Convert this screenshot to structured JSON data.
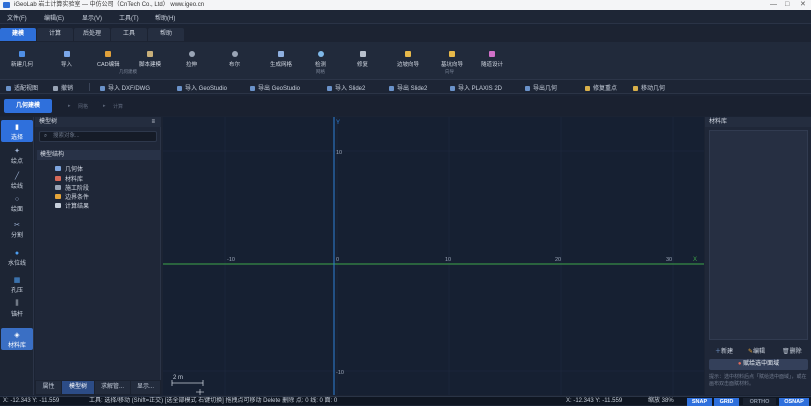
{
  "window": {
    "title": "iGeoLab 岩土计算实验室 — 中仿公司（CnTech Co., Ltd）  www.igeo.cn",
    "minimize": "—",
    "maximize": "□",
    "close": "✕"
  },
  "menu": [
    "文件(F)",
    "编辑(E)",
    "显示(V)",
    "工具(T)",
    "帮助(H)"
  ],
  "tabs": [
    "建模",
    "计算",
    "后处理",
    "工具",
    "帮助"
  ],
  "ribbon": {
    "buttons": [
      "新建几何",
      "导入",
      "CAD编辑",
      "脚本建模",
      "拉伸",
      "布尔",
      "生成网格",
      "检测",
      "修复",
      "边坡向导",
      "基坑向导",
      "隧道设计"
    ],
    "groups": [
      "几何建模",
      "网格",
      "向导"
    ]
  },
  "toolbar2": [
    "适配视图",
    "撤销",
    "导入 DXF/DWG",
    "导入 GeoStudio",
    "导出 GeoStudio",
    "导入 Slide2",
    "导出 Slide2",
    "导入 PLAXIS 2D",
    "导出几何",
    "修复重点",
    "移动几何"
  ],
  "mode": {
    "active": "几何建模",
    "crumbs": [
      "▸",
      "网格",
      "▸",
      "计算"
    ]
  },
  "left_tools": [
    "选择",
    "绘点",
    "绘线",
    "绘面",
    "分割",
    "水位线",
    "孔压",
    "锚杆",
    "材料库"
  ],
  "model_tree": {
    "header": "模型树",
    "pin": "≡",
    "search_placeholder": "搜索对象...",
    "structure_header": "模型结构",
    "items": [
      "几何体",
      "材料库",
      "施工阶段",
      "边界条件",
      "计算结果"
    ]
  },
  "bottom_tabs": [
    "属性",
    "模型树",
    "求解管...",
    "显示..."
  ],
  "canvas": {
    "x_ticks": [
      "-10",
      "0",
      "10",
      "20",
      "30"
    ],
    "y_ticks": [
      "10",
      "-10"
    ],
    "x_axis": "X",
    "y_axis": "Y",
    "scale": "2 m"
  },
  "material_panel": {
    "header": "材料库",
    "new": "新建",
    "edit": "编辑",
    "delete": "删除",
    "set_selected": "赋给选中面域",
    "hint": "提示：选中材料后点「赋给选中面域」，或在画布双击面赋材料。"
  },
  "status": {
    "coords_left": "X: -12.343  Y: -11.559",
    "tool_hint": "工具: 选择/移动 (Shift=正交) [选全部模式 右键切换] 拖拽点可移动 Delete 删除  点: 0  线: 0  面: 0",
    "coords_right": "X: -12.343  Y: -11.559",
    "zoom": "缩放 38%",
    "snap": "SNAP",
    "grid": "GRID",
    "ortho": "ORTHO",
    "osnap": "OSNAP"
  },
  "colors": {
    "accent": "#2f70dc",
    "x_axis": "#3ea64a",
    "y_axis": "#2f7fd6"
  }
}
